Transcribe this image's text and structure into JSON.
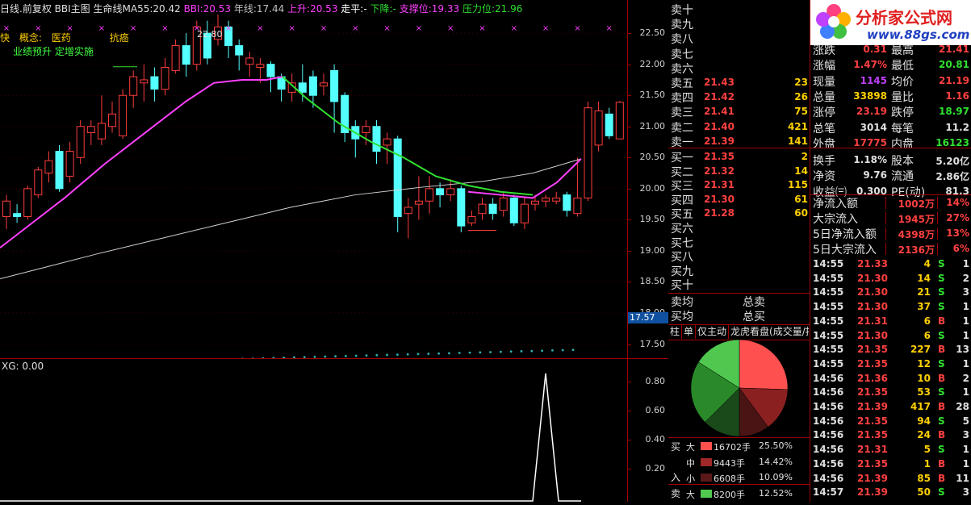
{
  "header": {
    "period": "日线.前复权",
    "indicator": "BBI主图",
    "line_ma55_label": "生命线MA55:",
    "line_ma55_value": "20.42",
    "bbi_label": "BBI:",
    "bbi_value": "20.53",
    "yearline_label": "年线:",
    "yearline_value": "17.44",
    "up_label": "上升:",
    "up_value": "20.53",
    "flat_label": "走平:",
    "flat_value": "-",
    "down_label": "下降:",
    "down_value": "-",
    "support_label": "支撑位:",
    "support_value": "19.33",
    "resist_label": "压力位:",
    "resist_value": "21.96"
  },
  "concepts": {
    "prefix": "快",
    "label": "概念:",
    "tag1": "医药",
    "tag2": "抗癌",
    "line2": "业绩预升 定增实施"
  },
  "chart_marks": {
    "high_label": "22.80",
    "current_price_tag": "17.57"
  },
  "main_axis": [
    "22.50",
    "22.00",
    "21.50",
    "21.00",
    "20.50",
    "20.00",
    "19.50",
    "19.00",
    "18.50",
    "18.00",
    "17.50"
  ],
  "indicator": {
    "title": "XG: 0.00",
    "axis": [
      "0.80",
      "0.60",
      "0.40",
      "0.20"
    ]
  },
  "order_book": {
    "sells": [
      {
        "label": "卖十",
        "price": "",
        "vol": ""
      },
      {
        "label": "卖九",
        "price": "",
        "vol": ""
      },
      {
        "label": "卖八",
        "price": "",
        "vol": ""
      },
      {
        "label": "卖七",
        "price": "",
        "vol": ""
      },
      {
        "label": "卖六",
        "price": "",
        "vol": ""
      },
      {
        "label": "卖五",
        "price": "21.43",
        "vol": "23"
      },
      {
        "label": "卖四",
        "price": "21.42",
        "vol": "26"
      },
      {
        "label": "卖三",
        "price": "21.41",
        "vol": "75"
      },
      {
        "label": "卖二",
        "price": "21.40",
        "vol": "421"
      },
      {
        "label": "卖一",
        "price": "21.39",
        "vol": "141"
      }
    ],
    "buys": [
      {
        "label": "买一",
        "price": "21.35",
        "vol": "2"
      },
      {
        "label": "买二",
        "price": "21.32",
        "vol": "14"
      },
      {
        "label": "买三",
        "price": "21.31",
        "vol": "115"
      },
      {
        "label": "买四",
        "price": "21.30",
        "vol": "61"
      },
      {
        "label": "买五",
        "price": "21.28",
        "vol": "60"
      },
      {
        "label": "买六",
        "price": "",
        "vol": ""
      },
      {
        "label": "买七",
        "price": "",
        "vol": ""
      },
      {
        "label": "买八",
        "price": "",
        "vol": ""
      },
      {
        "label": "买九",
        "price": "",
        "vol": ""
      },
      {
        "label": "买十",
        "price": "",
        "vol": ""
      }
    ],
    "avg_sell_label": "卖均",
    "total_sell_label": "总卖",
    "avg_buy_label": "买均",
    "total_buy_label": "总买"
  },
  "logo": {
    "title": "分析家公式网",
    "url": "www.88gs.com"
  },
  "quote": {
    "rows": [
      {
        "l1": "涨跌",
        "v1": "0.31",
        "l2": "最高",
        "v2": "21.41",
        "c1": "#ff4040",
        "c2": "#ff4040"
      },
      {
        "l1": "涨幅",
        "v1": "1.47%",
        "l2": "最低",
        "v2": "20.81",
        "c1": "#ff4040",
        "c2": "#30e030"
      },
      {
        "l1": "现量",
        "v1": "1145",
        "l2": "均价",
        "v2": "21.19",
        "c1": "#c040ff",
        "c2": "#ff4040"
      },
      {
        "l1": "总量",
        "v1": "33898",
        "l2": "量比",
        "v2": "1.16",
        "c1": "#ffd000",
        "c2": "#ff4040"
      },
      {
        "l1": "涨停",
        "v1": "23.19",
        "l2": "跌停",
        "v2": "18.97",
        "c1": "#ff4040",
        "c2": "#30e030"
      },
      {
        "l1": "总笔",
        "v1": "3014",
        "l2": "每笔",
        "v2": "11.2",
        "c1": "#e0e0e0",
        "c2": "#e0e0e0"
      },
      {
        "l1": "外盘",
        "v1": "17775",
        "l2": "内盘",
        "v2": "16123",
        "c1": "#ff4040",
        "c2": "#30e030"
      },
      {
        "l1": "换手",
        "v1": "1.18%",
        "l2": "股本",
        "v2": "5.20亿",
        "c1": "#e0e0e0",
        "c2": "#e0e0e0"
      },
      {
        "l1": "净资",
        "v1": "9.76",
        "l2": "流通",
        "v2": "2.86亿",
        "c1": "#e0e0e0",
        "c2": "#e0e0e0"
      },
      {
        "l1": "收益㈢",
        "v1": "0.300",
        "l2": "PE(动)",
        "v2": "81.3",
        "c1": "#e0e0e0",
        "c2": "#e0e0e0"
      }
    ],
    "flows": [
      {
        "label": "净流入额",
        "value": "1002万",
        "pct": "14%"
      },
      {
        "label": "大宗流入",
        "value": "1945万",
        "pct": "27%"
      },
      {
        "label": "5日净流入额",
        "value": "4398万",
        "pct": "13%"
      },
      {
        "label": "5日大宗流入",
        "value": "2136万",
        "pct": "6%"
      }
    ]
  },
  "ticks": [
    {
      "t": "14:55",
      "p": "21.33",
      "v": "4",
      "s": "S",
      "n": "1"
    },
    {
      "t": "14:55",
      "p": "21.30",
      "v": "14",
      "s": "S",
      "n": "2"
    },
    {
      "t": "14:55",
      "p": "21.30",
      "v": "21",
      "s": "S",
      "n": "3"
    },
    {
      "t": "14:55",
      "p": "21.30",
      "v": "37",
      "s": "S",
      "n": "1"
    },
    {
      "t": "14:55",
      "p": "21.31",
      "v": "6",
      "s": "B",
      "n": "1"
    },
    {
      "t": "14:55",
      "p": "21.30",
      "v": "6",
      "s": "S",
      "n": "1"
    },
    {
      "t": "14:55",
      "p": "21.35",
      "v": "227",
      "s": "B",
      "n": "13"
    },
    {
      "t": "14:55",
      "p": "21.35",
      "v": "12",
      "s": "S",
      "n": "1"
    },
    {
      "t": "14:56",
      "p": "21.36",
      "v": "10",
      "s": "B",
      "n": "2"
    },
    {
      "t": "14:56",
      "p": "21.35",
      "v": "53",
      "s": "S",
      "n": "1"
    },
    {
      "t": "14:56",
      "p": "21.39",
      "v": "417",
      "s": "B",
      "n": "28"
    },
    {
      "t": "14:56",
      "p": "21.35",
      "v": "94",
      "s": "S",
      "n": "5"
    },
    {
      "t": "14:56",
      "p": "21.35",
      "v": "24",
      "s": "B",
      "n": "3"
    },
    {
      "t": "14:56",
      "p": "21.31",
      "v": "5",
      "s": "S",
      "n": "1"
    },
    {
      "t": "14:56",
      "p": "21.35",
      "v": "1",
      "s": "B",
      "n": "1"
    },
    {
      "t": "14:56",
      "p": "21.39",
      "v": "85",
      "s": "B",
      "n": "11"
    },
    {
      "t": "14:57",
      "p": "21.39",
      "v": "50",
      "s": "S",
      "n": "3"
    }
  ],
  "flow_tabs": [
    "柱",
    "单",
    "仅主动",
    "龙虎看盘(成交量/按"
  ],
  "flow_table": {
    "side_buy": "买",
    "side_in": "入",
    "side_sell": "卖",
    "rows": [
      {
        "size": "大",
        "vol": "16702手",
        "pct": "25.50%",
        "color": "#ff5050"
      },
      {
        "size": "中",
        "vol": "9443手",
        "pct": "14.42%",
        "color": "#a02828"
      },
      {
        "size": "小",
        "vol": "6608手",
        "pct": "10.09%",
        "color": "#5a1818"
      },
      {
        "size": "大",
        "vol": "8200手",
        "pct": "12.52%",
        "color": "#50c850"
      }
    ]
  },
  "pie": {
    "slices": [
      {
        "pct": 25.5,
        "color": "#ff5050"
      },
      {
        "pct": 14.42,
        "color": "#8a2020"
      },
      {
        "pct": 10.09,
        "color": "#4a1414"
      },
      {
        "pct": 12.52,
        "color": "#1a4a1a"
      },
      {
        "pct": 21.47,
        "color": "#2a8a2a"
      },
      {
        "pct": 16.0,
        "color": "#50c850"
      }
    ]
  }
}
